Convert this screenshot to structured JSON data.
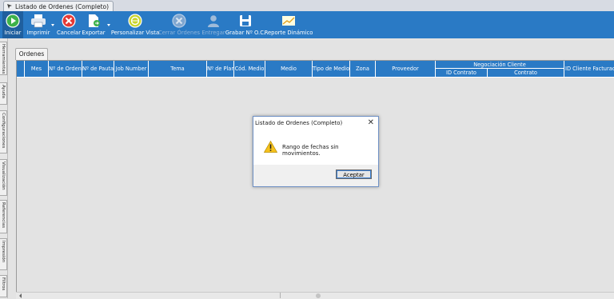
{
  "window": {
    "title": "Listado de Ordenes (Completo)"
  },
  "ribbon": {
    "iniciar": "Iniciar",
    "imprimir": "Imprimir",
    "cancelar": "Cancelar",
    "exportar": "Exportar",
    "personalizar": "Personalizar Vista",
    "cerrar_ordenes": "Cerrar Órdenes",
    "entregar": "Entregar",
    "grabar": "Grabar Nº O.C.",
    "reporte": "Reporte Dinámico"
  },
  "side_tabs": [
    "Herramientas",
    "Ayuda",
    "Configuraciones",
    "Visualización",
    "Referencias",
    "Impresión",
    "Filtros"
  ],
  "tab": {
    "label": "Ordenes"
  },
  "grid": {
    "columns": {
      "mes": "Mes",
      "num_orden": "Nº de Orden",
      "num_pauta": "Nº de Pauta",
      "job_number": "Job Number",
      "tema": "Tema",
      "num_plan": "Nº de Plan",
      "cod_medio": "Cód. Medio",
      "medio": "Medio",
      "tipo_medio": "Tipo de Medio",
      "zona": "Zona",
      "proveedor": "Proveedor",
      "negociacion": "Negociación Cliente",
      "id_contrato": "ID Contrato",
      "contrato": "Contrato",
      "id_cliente": "ID Cliente Facturacion"
    }
  },
  "dialog": {
    "title": "Listado de Ordenes (Completo)",
    "message": "Rango de fechas sin movimientos.",
    "ok": "Aceptar"
  }
}
